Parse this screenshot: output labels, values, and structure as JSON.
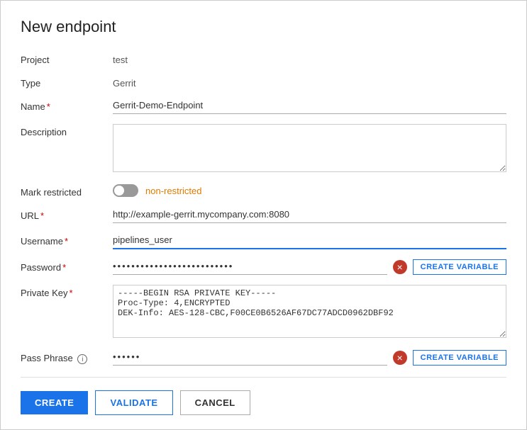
{
  "dialog": {
    "title": "New endpoint"
  },
  "form": {
    "project_label": "Project",
    "project_value": "test",
    "type_label": "Type",
    "type_value": "Gerrit",
    "name_label": "Name",
    "name_required": "*",
    "name_value": "Gerrit-Demo-Endpoint",
    "description_label": "Description",
    "description_value": "",
    "description_placeholder": "",
    "mark_restricted_label": "Mark restricted",
    "mark_restricted_toggle_label": "non-restricted",
    "url_label": "URL",
    "url_required": "*",
    "url_value": "http://example-gerrit.mycompany.com:8080",
    "username_label": "Username",
    "username_required": "*",
    "username_value": "pipelines_user",
    "password_label": "Password",
    "password_required": "*",
    "password_value": "••••••••••••••••••••••••••",
    "create_variable_label": "CREATE VARIABLE",
    "private_key_label": "Private Key",
    "private_key_required": "*",
    "private_key_value": "-----BEGIN RSA PRIVATE KEY-----\nProc-Type: 4,ENCRYPTED\nDEK-Info: AES-128-CBC,F00CE0B6526AF67DC77ADCD0962DBF92",
    "pass_phrase_label": "Pass Phrase",
    "pass_phrase_value": "••••••",
    "pass_phrase_create_variable_label": "CREATE VARIABLE"
  },
  "footer": {
    "create_label": "CREATE",
    "validate_label": "VALIDATE",
    "cancel_label": "CANCEL"
  }
}
